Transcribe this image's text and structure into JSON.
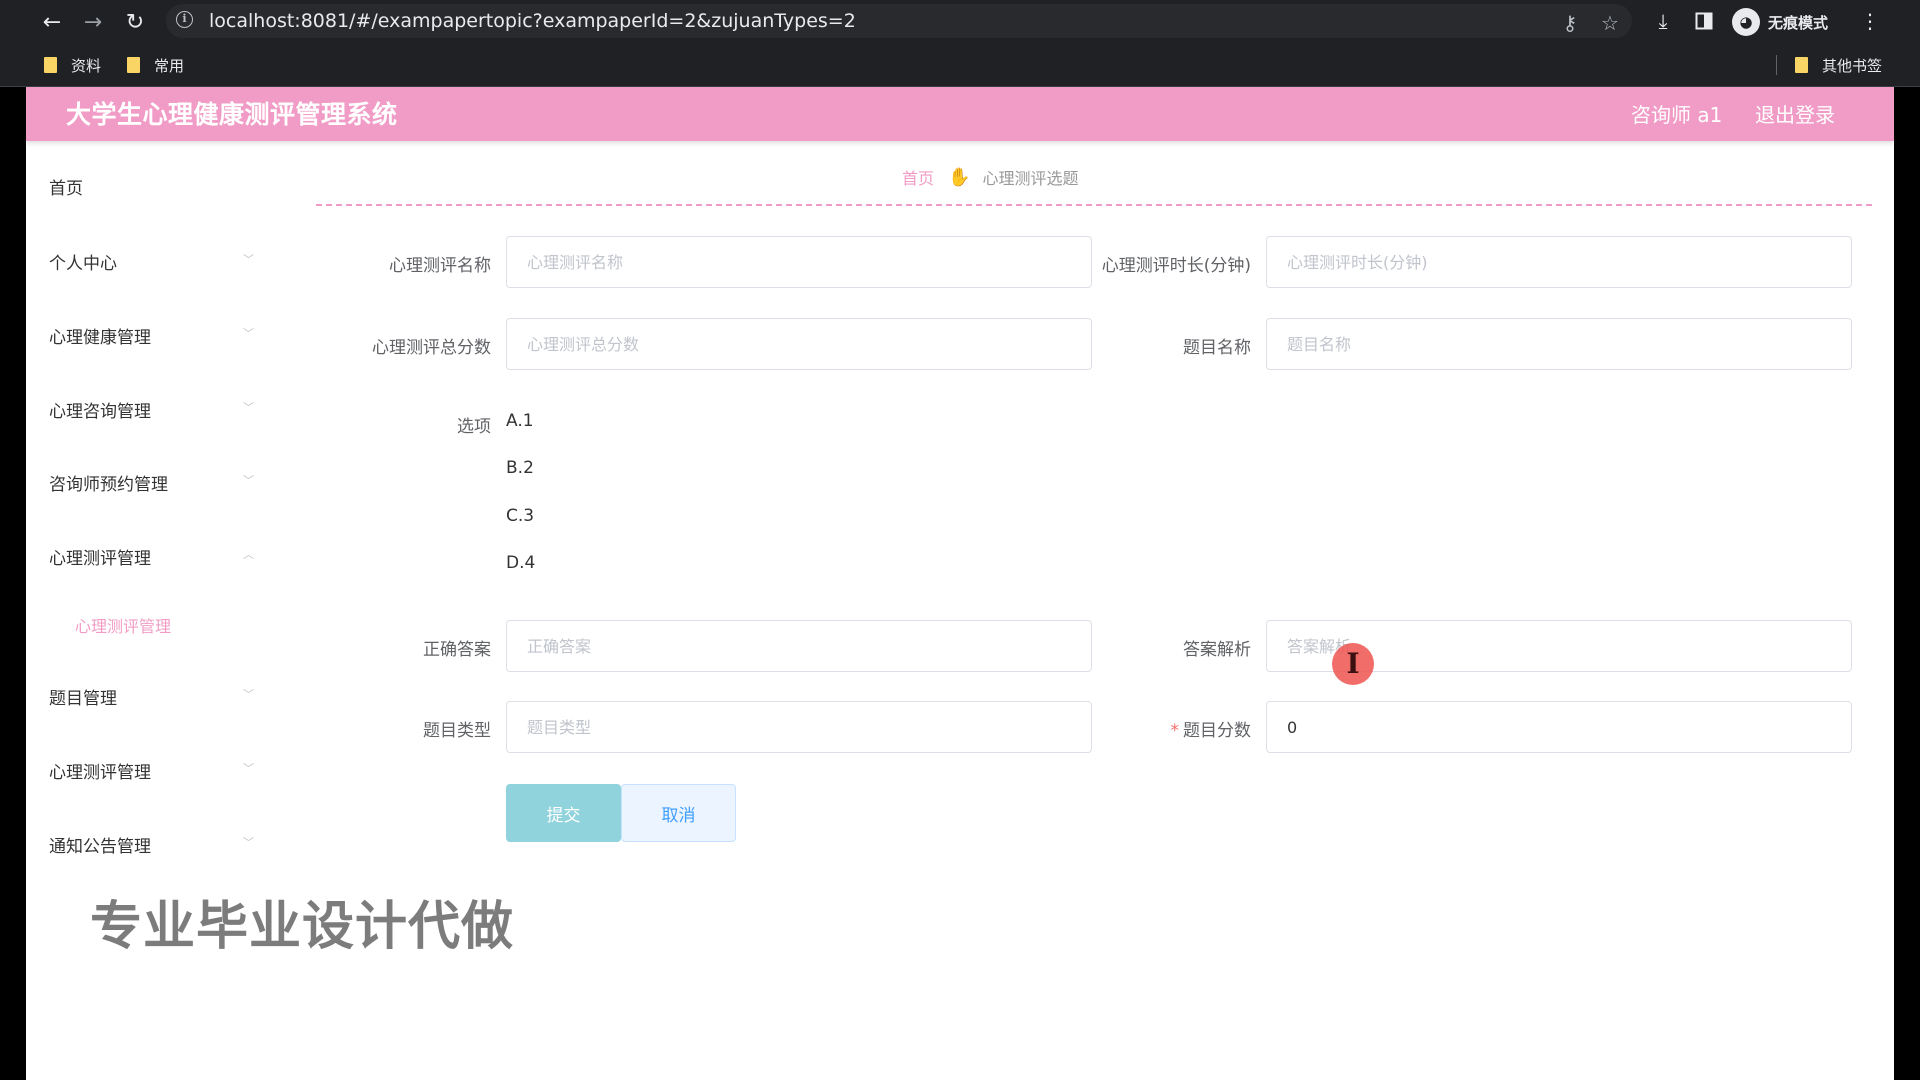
{
  "browser": {
    "url": "localhost:8081/#/exampapertopic?exampaperId=2&zujuanTypes=2",
    "profile_label": "无痕模式",
    "bookmarks": [
      "资料",
      "常用"
    ],
    "other_bookmarks": "其他书签"
  },
  "header": {
    "title": "大学生心理健康测评管理系统",
    "user": "咨询师 a1",
    "logout": "退出登录"
  },
  "sidebar": {
    "items": [
      {
        "label": "首页"
      },
      {
        "label": "个人中心"
      },
      {
        "label": "心理健康管理"
      },
      {
        "label": "心理咨询管理"
      },
      {
        "label": "咨询师预约管理"
      },
      {
        "label": "心理测评管理",
        "expanded": true
      },
      {
        "label": "心理测评管理",
        "submenu": true
      },
      {
        "label": "题目管理"
      },
      {
        "label": "心理测评管理"
      },
      {
        "label": "通知公告管理"
      }
    ]
  },
  "breadcrumb": {
    "home": "首页",
    "current": "心理测评选题"
  },
  "form": {
    "exam_name": {
      "label": "心理测评名称",
      "placeholder": "心理测评名称",
      "value": ""
    },
    "exam_duration": {
      "label": "心理测评时长(分钟)",
      "placeholder": "心理测评时长(分钟)",
      "value": ""
    },
    "exam_total": {
      "label": "心理测评总分数",
      "placeholder": "心理测评总分数",
      "value": ""
    },
    "question_name": {
      "label": "题目名称",
      "placeholder": "题目名称",
      "value": ""
    },
    "options": {
      "label": "选项",
      "items": [
        "A.1",
        "B.2",
        "C.3",
        "D.4"
      ]
    },
    "correct_answer": {
      "label": "正确答案",
      "placeholder": "正确答案",
      "value": ""
    },
    "analysis": {
      "label": "答案解析",
      "placeholder": "答案解析",
      "value": ""
    },
    "question_type": {
      "label": "题目类型",
      "placeholder": "题目类型",
      "value": ""
    },
    "question_score": {
      "label": "题目分数",
      "required_mark": "*",
      "value": "0"
    },
    "submit": "提交",
    "cancel": "取消"
  },
  "overlay": {
    "watermark": "专业毕业设计代做",
    "cursor_glyph": "I"
  }
}
